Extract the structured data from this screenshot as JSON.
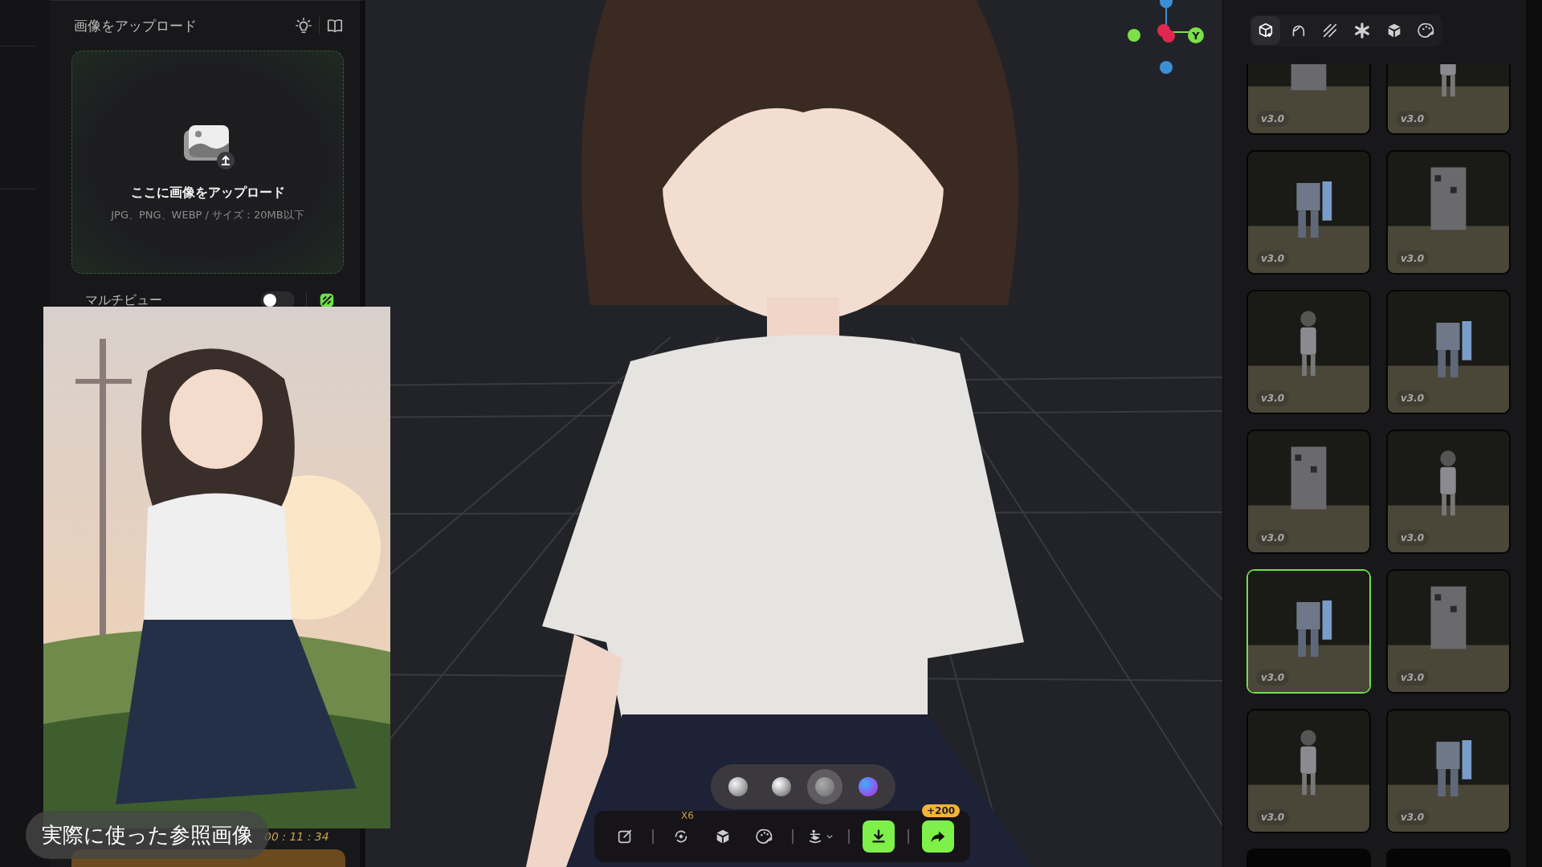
{
  "left_panel": {
    "title": "画像をアップロード",
    "upload": {
      "title": "ここに画像をアップロード",
      "hint": "JPG、PNG、WEBP / サイズ：20MB以下"
    },
    "multiview": {
      "label": "マルチビュー",
      "on": false
    },
    "timer": "00 : 11 : 34"
  },
  "reference": {
    "kind": "picture",
    "caption": "実際に使った参照画像"
  },
  "viewport": {
    "kind": "picture",
    "axis_label": "Y",
    "materials": [
      {
        "kind": "matte",
        "selected": false
      },
      {
        "kind": "chrome",
        "selected": false
      },
      {
        "kind": "clay",
        "selected": true
      },
      {
        "kind": "gradient",
        "selected": false
      }
    ],
    "toolbar_groups": [
      [
        {
          "kind": "edit",
          "accent": false
        }
      ],
      [
        {
          "kind": "retopo",
          "accent": false,
          "badge": "X6"
        },
        {
          "kind": "parts",
          "accent": false
        },
        {
          "kind": "texture",
          "accent": false
        }
      ],
      [
        {
          "kind": "rig",
          "accent": false,
          "dropdown": true
        }
      ],
      [
        {
          "kind": "download",
          "accent": true
        }
      ],
      [
        {
          "kind": "share",
          "accent": true,
          "badge": "+200"
        }
      ]
    ]
  },
  "right_panel": {
    "tabs": [
      {
        "kind": "model",
        "selected": true
      },
      {
        "kind": "head",
        "selected": false
      },
      {
        "kind": "stripes",
        "selected": false
      },
      {
        "kind": "gear",
        "selected": false
      },
      {
        "kind": "parts",
        "selected": false
      },
      {
        "kind": "texture",
        "selected": false
      }
    ],
    "cards": [
      {
        "kind": "picture",
        "label": "v3.0",
        "selected": false
      },
      {
        "kind": "picture",
        "label": "v3.0",
        "selected": false
      },
      {
        "kind": "picture",
        "label": "v3.0",
        "selected": false
      },
      {
        "kind": "picture",
        "label": "v3.0",
        "selected": false
      },
      {
        "kind": "picture",
        "label": "v3.0",
        "selected": false
      },
      {
        "kind": "picture",
        "label": "v3.0",
        "selected": false
      },
      {
        "kind": "picture",
        "label": "v3.0",
        "selected": false
      },
      {
        "kind": "picture",
        "label": "v3.0",
        "selected": false
      },
      {
        "kind": "picture",
        "label": "v3.0",
        "selected": true
      },
      {
        "kind": "picture",
        "label": "v3.0",
        "selected": false
      },
      {
        "kind": "picture",
        "label": "v3.0",
        "selected": false
      },
      {
        "kind": "picture",
        "label": "v3.0",
        "selected": false
      },
      {
        "kind": "blank",
        "selected": false
      },
      {
        "kind": "blank",
        "selected": false
      }
    ]
  }
}
